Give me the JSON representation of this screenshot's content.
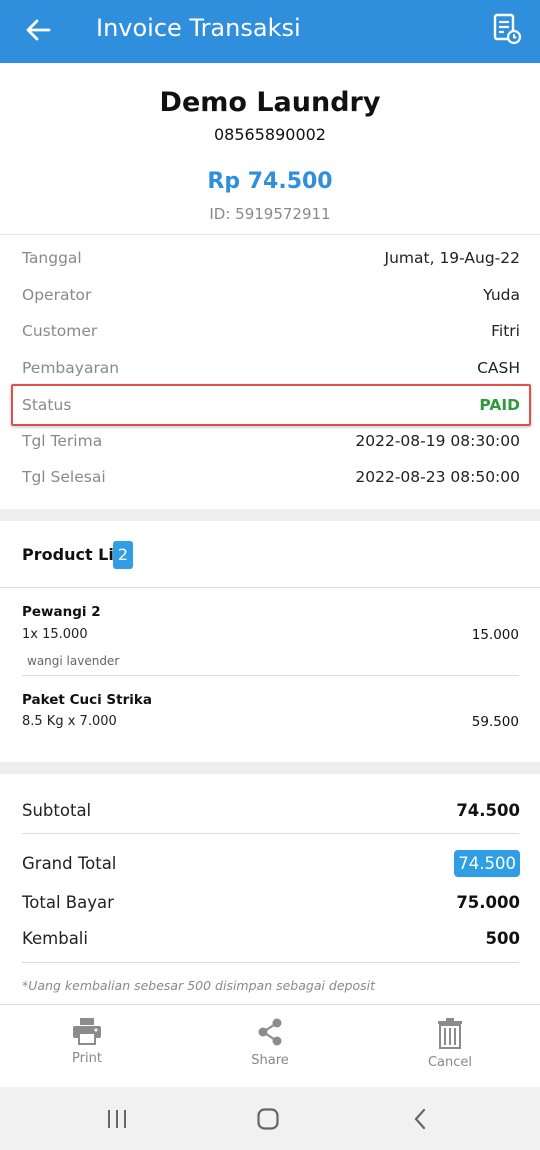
{
  "appbar": {
    "title": "Invoice Transaksi",
    "back_icon": "arrow-left-icon",
    "history_icon": "receipt-clock-icon",
    "color": "#2f8fdc"
  },
  "invoice": {
    "store_name": "Demo Laundry",
    "phone": "08565890002",
    "amount": "Rp 74.500",
    "id_text": "ID: 5919572911"
  },
  "details": [
    {
      "label": "Tanggal",
      "value": "Jumat, 19-Aug-22"
    },
    {
      "label": "Operator",
      "value": "Yuda"
    },
    {
      "label": "Customer",
      "value": "Fitri"
    },
    {
      "label": "Pembayaran",
      "value": "CASH"
    },
    {
      "label": "Status",
      "value": "PAID"
    },
    {
      "label": "Tgl Terima",
      "value": "2022-08-19 08:30:00"
    },
    {
      "label": "Tgl Selesai",
      "value": "2022-08-23 08:50:00"
    }
  ],
  "product_list": {
    "title": "Product List",
    "count": "2",
    "items": [
      {
        "name": "Pewangi 2",
        "qty": "1x 15.000",
        "total": "15.000",
        "note": "wangi lavender"
      },
      {
        "name": "Paket Cuci Strika",
        "qty": "8.5 Kg x 7.000",
        "total": "59.500"
      }
    ]
  },
  "summary": {
    "subtotal_label": "Subtotal",
    "subtotal": "74.500",
    "grand_total_label": "Grand Total",
    "grand_total": "74.500",
    "total_bayar_label": "Total Bayar",
    "total_bayar": "75.000",
    "kembali_label": "Kembali",
    "kembali": "500",
    "note": "*Uang kembalian sebesar 500 disimpan sebagai deposit"
  },
  "actions": [
    {
      "label": "Print",
      "icon": "printer-icon"
    },
    {
      "label": "Share",
      "icon": "share-icon"
    },
    {
      "label": "Cancel",
      "icon": "trash-icon"
    }
  ],
  "colors": {
    "accent": "#2f8fdc",
    "paid": "#2e9a3c",
    "highlight": "#e0504a"
  }
}
